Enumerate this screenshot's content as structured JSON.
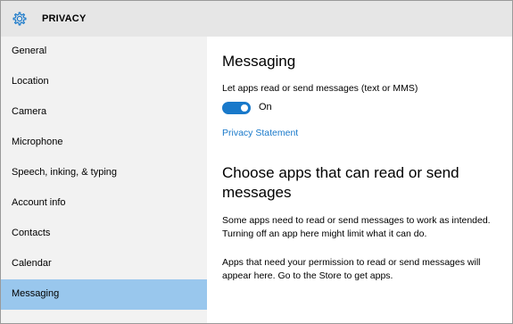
{
  "app": {
    "title": "PRIVACY",
    "title_icon": "gear-icon",
    "accent_color": "#1979ca",
    "selected_color": "#99c7ed"
  },
  "sidebar": {
    "items": [
      {
        "label": "General"
      },
      {
        "label": "Location"
      },
      {
        "label": "Camera"
      },
      {
        "label": "Microphone"
      },
      {
        "label": "Speech, inking, & typing"
      },
      {
        "label": "Account info"
      },
      {
        "label": "Contacts"
      },
      {
        "label": "Calendar"
      },
      {
        "label": "Messaging",
        "selected": true
      }
    ]
  },
  "main": {
    "section_title": "Messaging",
    "setting_label": "Let apps read or send messages (text or MMS)",
    "toggle": {
      "state_label": "On",
      "on": true
    },
    "privacy_link": "Privacy Statement",
    "choose_title_line1": "Choose apps that can read or send",
    "choose_title_line2": "messages",
    "info1_line1": "Some apps need to read or send messages to work as intended.",
    "info1_line2": "Turning off an app here might limit what it can do.",
    "info2_line1": "Apps that need your permission to read or send messages will",
    "info2_line2": "appear here. Go to the Store to get apps."
  }
}
